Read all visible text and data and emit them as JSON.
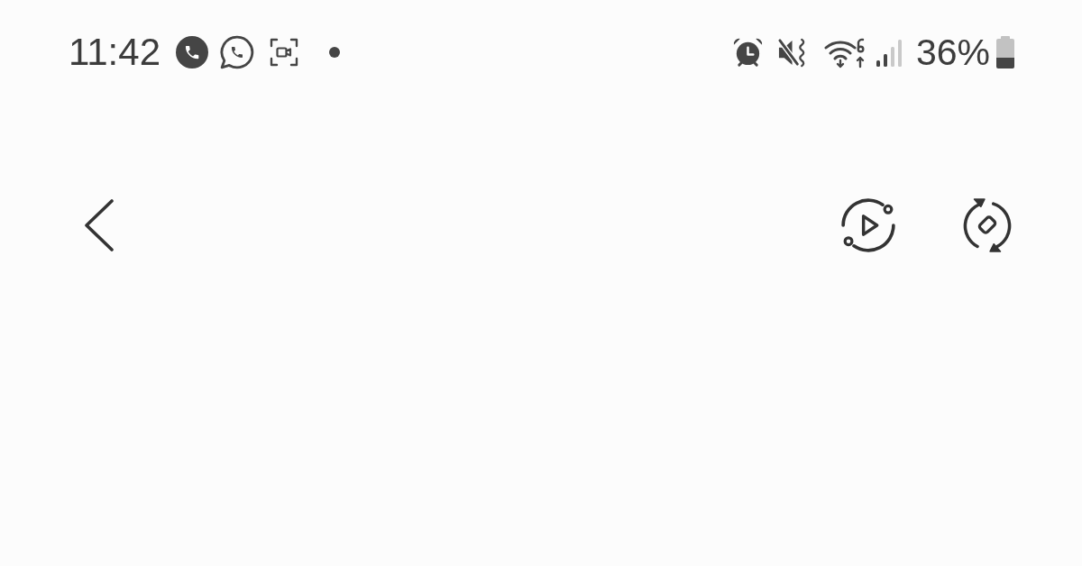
{
  "status_bar": {
    "time": "11:42",
    "battery_percentage": "36%"
  }
}
